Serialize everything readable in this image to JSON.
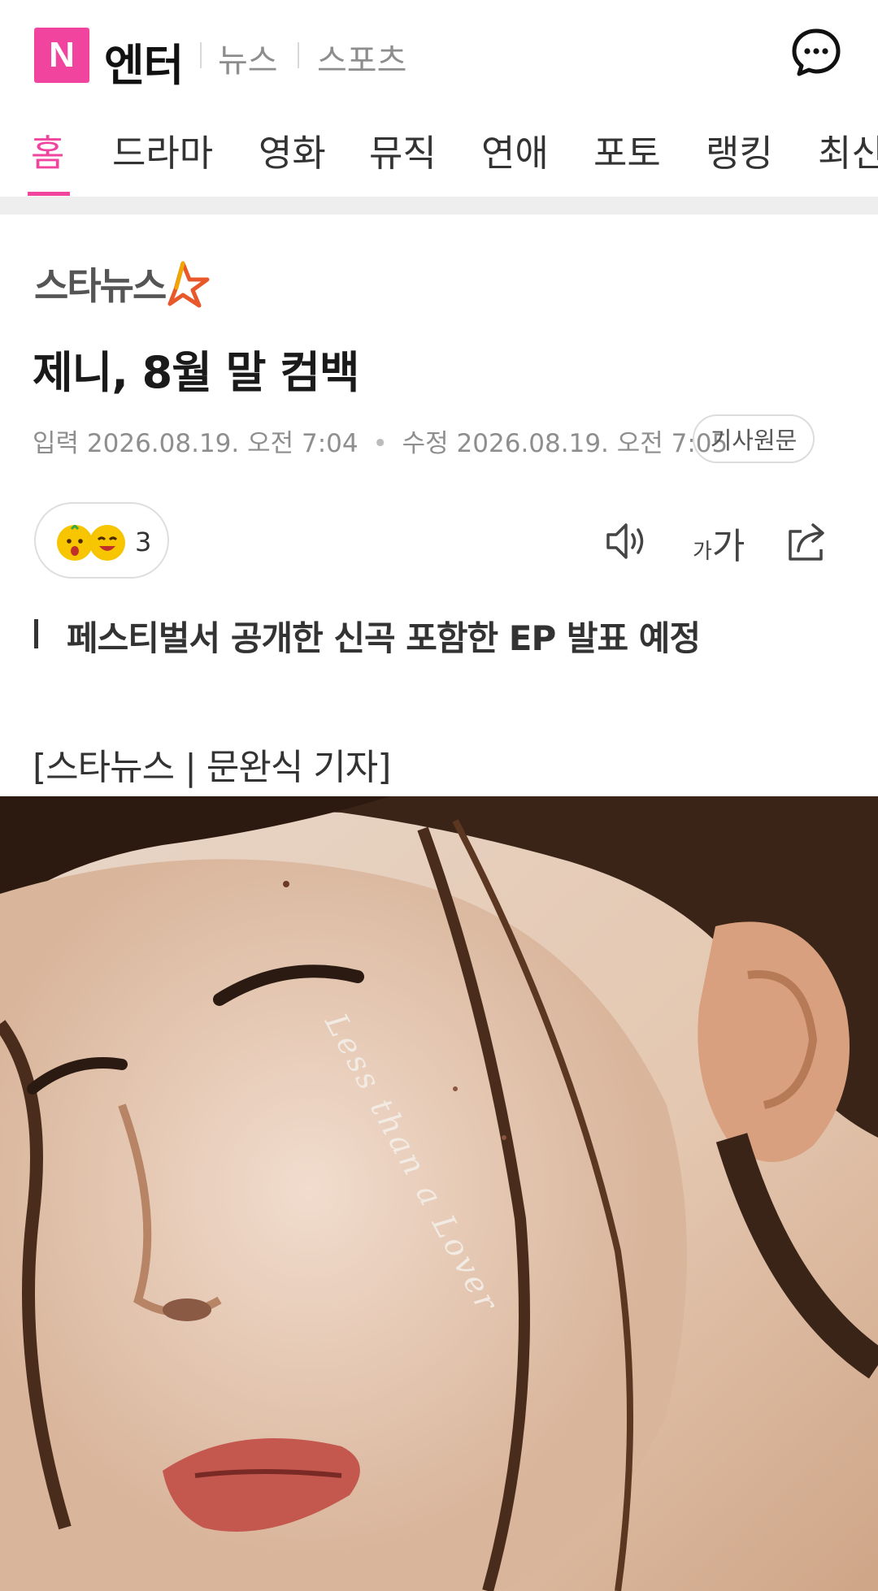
{
  "header": {
    "logo_letter": "N",
    "brand": "엔터",
    "subnav": [
      "뉴스",
      "스포츠"
    ]
  },
  "tabs": [
    {
      "label": "홈",
      "active": true
    },
    {
      "label": "드라마"
    },
    {
      "label": "영화"
    },
    {
      "label": "뮤직"
    },
    {
      "label": "연애"
    },
    {
      "label": "포토"
    },
    {
      "label": "랭킹"
    },
    {
      "label": "최신"
    }
  ],
  "article": {
    "press": "스타뉴스",
    "title": "제니, 8월 말 컴백",
    "input_label": "입력",
    "input_time": "2026.08.19. 오전 7:04",
    "edit_label": "수정",
    "edit_time": "2026.08.19. 오전 7:05",
    "original_button": "기사원문",
    "reaction_count": "3",
    "font_small": "가",
    "font_large": "가",
    "subtitle": "페스티벌서 공개한 신곡 포함한 EP 발표 예정",
    "byline": "[스타뉴스 | 문완식 기자]",
    "photo_text": "Less than a Lover"
  },
  "colors": {
    "accent": "#f0449f",
    "press_star": "#e8582a"
  },
  "icons": {
    "chat": "chat-bubble-dots-icon",
    "listen": "speaker-icon",
    "font": "font-size-icon",
    "share": "share-icon"
  }
}
